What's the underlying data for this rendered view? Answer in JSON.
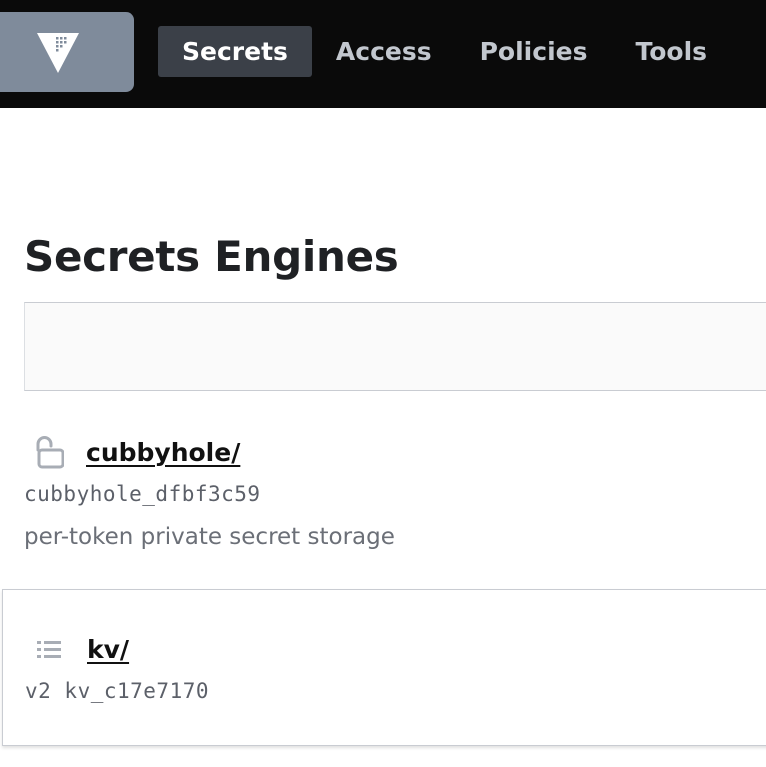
{
  "nav": {
    "logo": "vault-logo-icon",
    "items": [
      {
        "label": "Secrets",
        "active": true
      },
      {
        "label": "Access",
        "active": false
      },
      {
        "label": "Policies",
        "active": false
      },
      {
        "label": "Tools",
        "active": false
      }
    ]
  },
  "page": {
    "title": "Secrets Engines"
  },
  "engines": [
    {
      "path": "cubbyhole/",
      "icon": "unlocked-padlock-icon",
      "accessor": "cubbyhole_dfbf3c59",
      "description": "per-token private secret storage"
    },
    {
      "path": "kv/",
      "icon": "list-icon",
      "accessor": "v2 kv_c17e7170"
    }
  ],
  "colors": {
    "topbar": "#0a0a0a",
    "logo_bg": "#7f8b9b",
    "nav_active_bg": "#3b4048"
  }
}
